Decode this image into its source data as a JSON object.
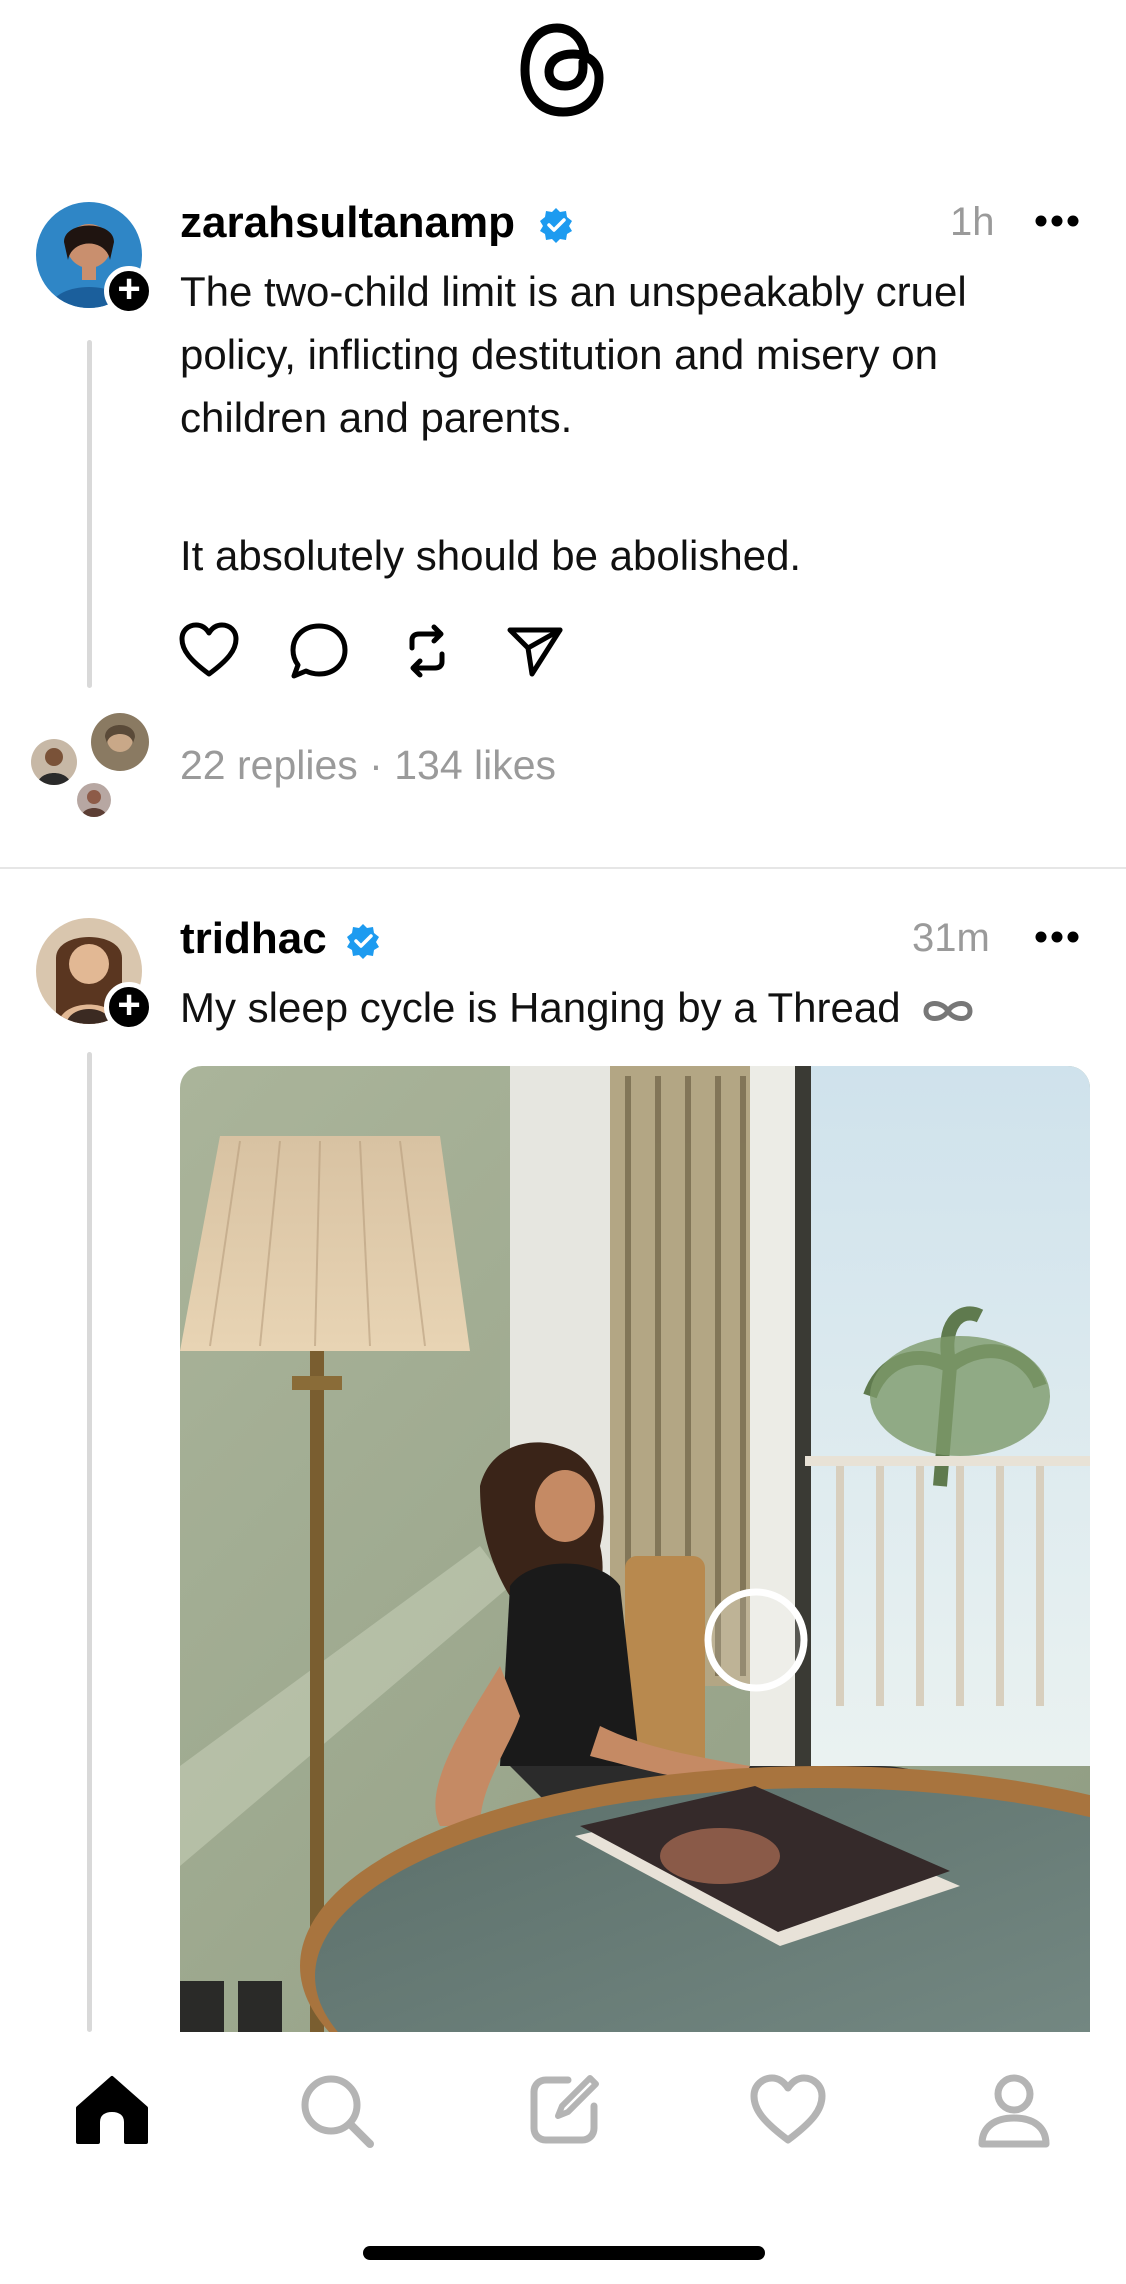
{
  "header": {
    "logo_icon": "threads-logo-icon"
  },
  "posts": [
    {
      "username": "zarahsultanamp",
      "verified": true,
      "timestamp": "1h",
      "text_lines": [
        "The two-child limit is an unspeakably cruel",
        "policy, inflicting destitution and misery on",
        "children and parents."
      ],
      "text_line_2": "It absolutely should be abolished.",
      "stats": "22 replies · 134 likes",
      "actions": [
        "heart-icon",
        "comment-icon",
        "repost-icon",
        "share-icon"
      ]
    },
    {
      "username": "tridhac",
      "verified": true,
      "timestamp": "31m",
      "text": "My sleep cycle is Hanging by a Thread",
      "text_suffix_icon": "infinity-icon",
      "media": "photo"
    }
  ],
  "tabbar": {
    "items": [
      "home-icon",
      "search-icon",
      "compose-icon",
      "activity-heart-icon",
      "profile-icon"
    ],
    "active": "home-icon"
  },
  "colors": {
    "verified_blue": "#1d9bf0",
    "muted_text": "#9a9a9a",
    "divider": "#e6e6e6"
  }
}
